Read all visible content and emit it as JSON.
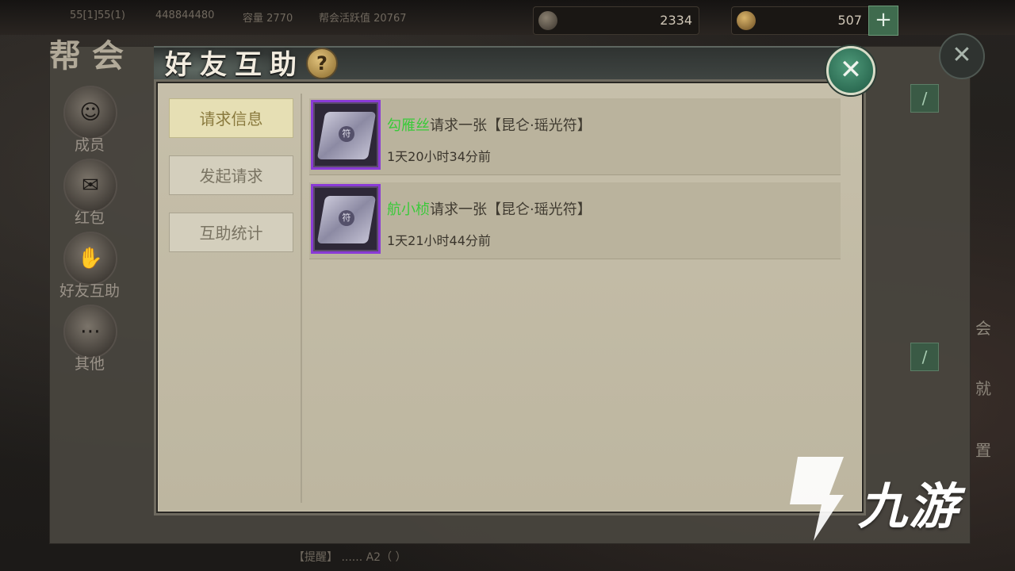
{
  "topbar": {
    "stat1": "55[1]55(1)",
    "stat2": "448844480",
    "stat3": "容量 2770",
    "stat4": "帮会活跃值 20767",
    "silver_value": "2334",
    "gold_value": "507",
    "plus_label": "+"
  },
  "guild": {
    "title": "帮会",
    "close_label": "✕",
    "nav": [
      {
        "label": "成员",
        "icon": "member-icon"
      },
      {
        "label": "红包",
        "icon": "red-packet-icon"
      },
      {
        "label": "好友互助",
        "icon": "handshake-icon"
      },
      {
        "label": "其他",
        "icon": "scroll-icon"
      }
    ],
    "right_labels": [
      "会",
      "就",
      "置"
    ]
  },
  "dialog": {
    "title": "好友互助",
    "help_label": "?",
    "close_label": "✕",
    "tabs": [
      {
        "label": "请求信息",
        "active": true
      },
      {
        "label": "发起请求",
        "active": false
      },
      {
        "label": "互助统计",
        "active": false
      }
    ],
    "requests": [
      {
        "player": "勾雁丝",
        "text": "请求一张【昆仑·瑶光符】",
        "time": "1天20小时34分前"
      },
      {
        "player": "航小桢",
        "text": "请求一张【昆仑·瑶光符】",
        "time": "1天21小时44分前"
      }
    ]
  },
  "bottom": {
    "chat": "【提醒】 ......  A2（  ）"
  },
  "watermark": {
    "text": "九游"
  },
  "colors": {
    "player_name": "#3aca3a",
    "item_border": "#8a3bd6",
    "close_button": "#2f7a5c"
  }
}
